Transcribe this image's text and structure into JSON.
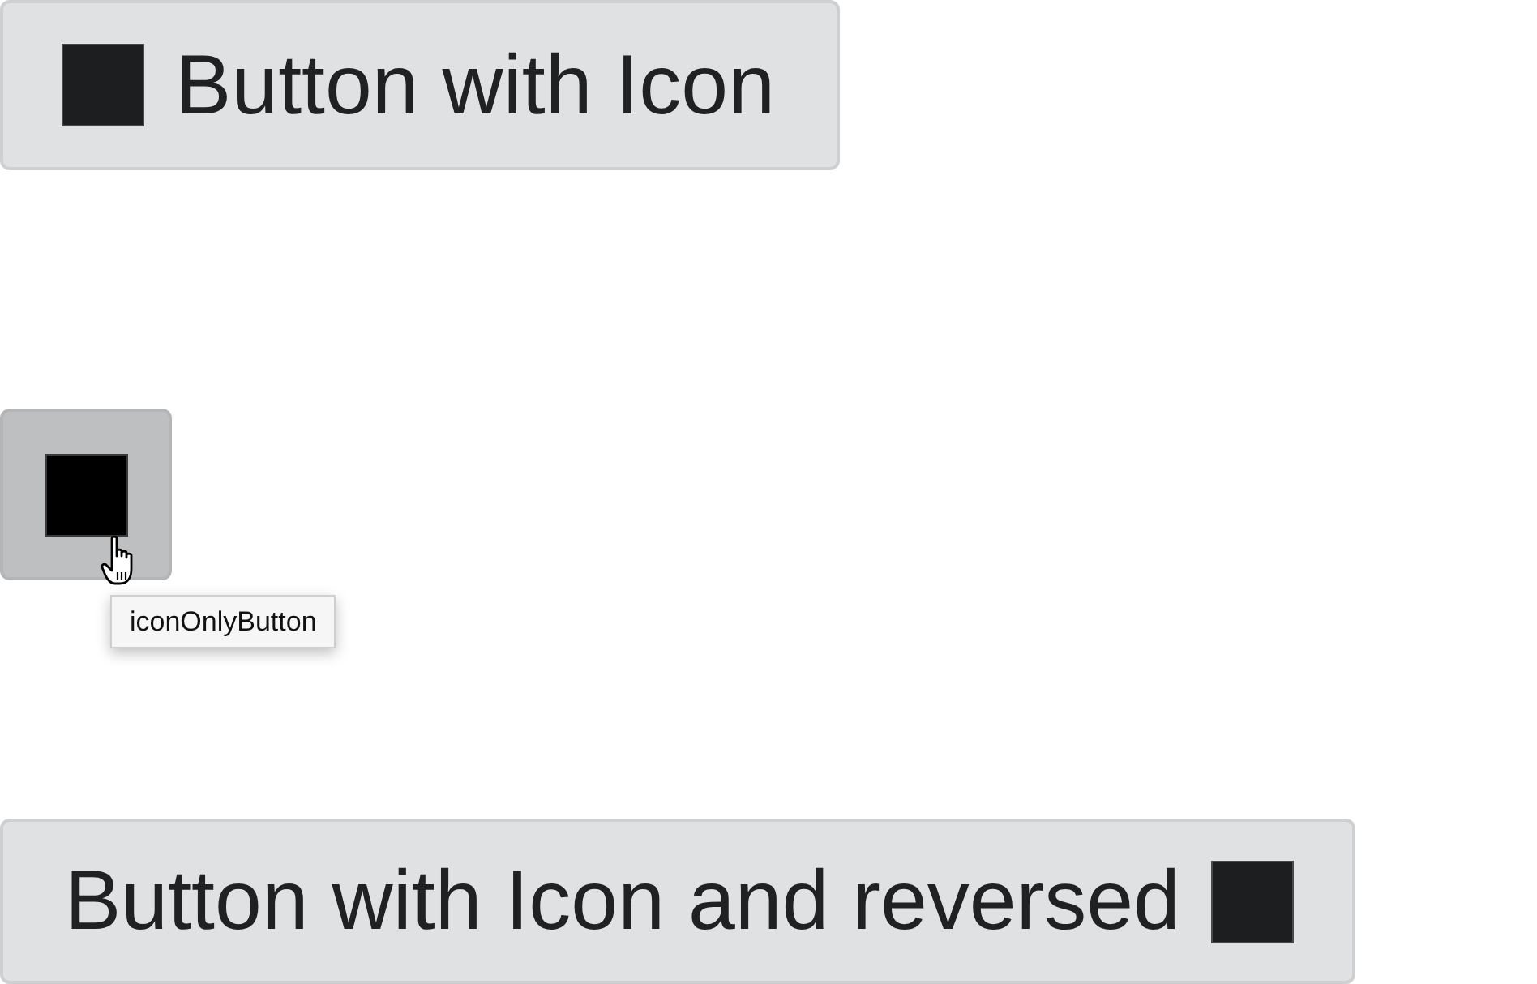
{
  "buttons": [
    {
      "kind": "icon-left",
      "label": "Button with Icon",
      "hovered": false
    },
    {
      "kind": "icon-only",
      "hovered": true,
      "tooltip": "iconOnlyButton"
    },
    {
      "kind": "icon-right",
      "label": "Button with Icon and reversed",
      "hovered": false
    }
  ]
}
